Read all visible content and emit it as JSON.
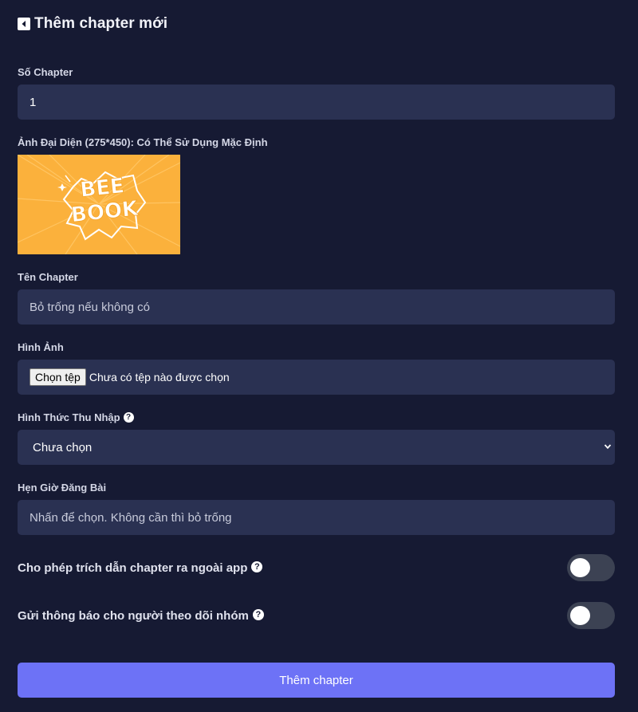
{
  "header": {
    "title": "Thêm chapter mới"
  },
  "chapter_number": {
    "label": "Số Chapter",
    "value": "1"
  },
  "cover": {
    "label": "Ảnh Đại Diện (275*450): Có Thể Sử Dụng Mặc Định",
    "logo_text": "BEE BOOK",
    "background_color": "#fbb13c"
  },
  "chapter_name": {
    "label": "Tên Chapter",
    "placeholder": "Bỏ trống nếu không có"
  },
  "image_upload": {
    "label": "Hình Ảnh",
    "button_label": "Chọn tệp",
    "status": "Chưa có tệp nào được chọn"
  },
  "income_type": {
    "label": "Hình Thức Thu Nhập",
    "selected": "Chưa chọn"
  },
  "schedule": {
    "label": "Hẹn Giờ Đăng Bài",
    "placeholder": "Nhấn để chọn. Không cần thì bỏ trống"
  },
  "toggles": [
    {
      "label": "Cho phép trích dẫn chapter ra ngoài app",
      "on": false
    },
    {
      "label": "Gửi thông báo cho người theo dõi nhóm",
      "on": false
    }
  ],
  "submit": {
    "label": "Thêm chapter"
  },
  "colors": {
    "background": "#161a33",
    "field": "#2a3152",
    "accent": "#6d72f6",
    "toggle_off": "#3c4253"
  }
}
